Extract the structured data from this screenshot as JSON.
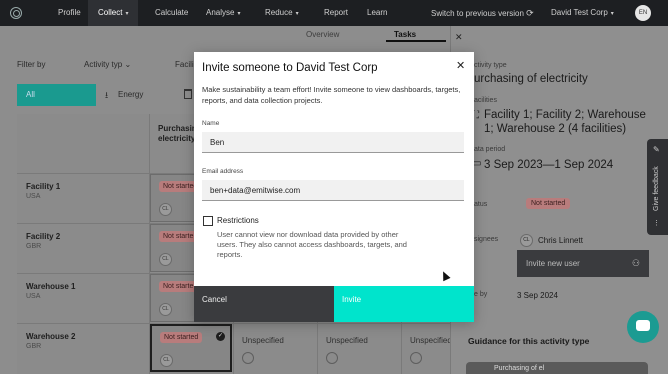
{
  "nav": {
    "items": [
      {
        "label": "Profile"
      },
      {
        "label": "Collect",
        "active": true
      },
      {
        "label": "Calculate"
      },
      {
        "label": "Analyse"
      },
      {
        "label": "Reduce"
      },
      {
        "label": "Report"
      },
      {
        "label": "Learn"
      }
    ],
    "switch_label": "Switch to previous version",
    "company": "David Test Corp",
    "avatar_initials": "EN"
  },
  "subtabs": {
    "overview": "Overview",
    "tasks": "Tasks"
  },
  "filters": {
    "label": "Filter by",
    "activity_type": "Activity typ",
    "facility": "Facili",
    "pill_all": "All",
    "pill_energy": "Energy"
  },
  "grid": {
    "column_header": "Purchasin\nelectricity",
    "rows": [
      {
        "name": "Facility 1",
        "country": "USA",
        "status": "Not started",
        "assignee": "CL"
      },
      {
        "name": "Facility 2",
        "country": "GBR",
        "status": "Not starte",
        "assignee": "CL"
      },
      {
        "name": "Warehouse 1",
        "country": "USA",
        "status": "Not starte",
        "assignee": "CL"
      },
      {
        "name": "Warehouse 2",
        "country": "GBR",
        "status": "Not started",
        "assignee": "CL"
      }
    ],
    "unspecified": "Unspecified"
  },
  "panel": {
    "activity_type_label": "ctivity type",
    "activity_type_value": "urchasing of electricity",
    "facilities_label": "acilities",
    "facilities_value": "Facility 1; Facility 2; Warehouse 1; Warehouse 2 (4 facilities)",
    "data_period_label": "ata period",
    "data_period_value": "3 Sep 2023—1 Sep 2024",
    "status_label": "atus",
    "status_value": "Not started",
    "assignees_label": "signees",
    "assignee_initials": "CL",
    "assignee_name": "Chris Linnett",
    "invite_placeholder": "Invite new user",
    "due_label": "e by",
    "due_value": "3 Sep 2024",
    "guidance_title": "Guidance for this activity type",
    "guidance_thumb": "Purchasing of el"
  },
  "feedback": {
    "label": "Give feedback"
  },
  "modal": {
    "title": "Invite someone to David Test Corp",
    "description": "Make sustainability a team effort! Invite someone to view dashboards, targets, reports, and data collection projects.",
    "name_label": "Name",
    "name_value": "Ben",
    "email_label": "Email address",
    "email_value": "ben+data@emitwise.com",
    "restrictions_label": "Restrictions",
    "restrictions_help": "User cannot view nor download data provided by other users. They also cannot access dashboards, targets, and reports.",
    "cancel_label": "Cancel",
    "invite_label": "Invite"
  },
  "colors": {
    "accent": "#00e4cc",
    "dark": "#1d1f22",
    "badge": "#d79b9b"
  }
}
